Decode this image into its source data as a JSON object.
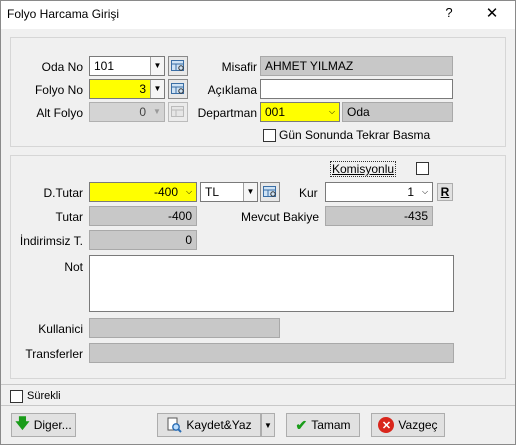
{
  "window": {
    "title": "Folyo Harcama Girişi",
    "help": "?",
    "close": "✕"
  },
  "top": {
    "oda_no": {
      "label": "Oda No",
      "value": "101"
    },
    "folyo_no": {
      "label": "Folyo No",
      "value": "3"
    },
    "alt_folyo": {
      "label": "Alt Folyo",
      "value": "0"
    },
    "misafir": {
      "label": "Misafir",
      "value": "AHMET YILMAZ"
    },
    "aciklama": {
      "label": "Açıklama",
      "value": ""
    },
    "departman": {
      "label": "Departman",
      "code": "001",
      "name": "Oda"
    },
    "gun_sonu": {
      "label": "Gün Sonunda Tekrar Basma",
      "checked": false
    }
  },
  "mid": {
    "komisyonlu": {
      "label": "Komisyonlu",
      "checked": false
    },
    "d_tutar": {
      "label": "D.Tutar",
      "value": "-400",
      "currency": "TL"
    },
    "kur": {
      "label": "Kur",
      "value": "1",
      "r_button": "R"
    },
    "tutar": {
      "label": "Tutar",
      "value": "-400"
    },
    "mevcut_bakiye": {
      "label": "Mevcut Bakiye",
      "value": "-435"
    },
    "indirimsiz": {
      "label": "İndirimsiz T.",
      "value": "0"
    },
    "not": {
      "label": "Not",
      "value": ""
    },
    "kullanici": {
      "label": "Kullanici",
      "value": ""
    },
    "transferler": {
      "label": "Transferler",
      "value": ""
    }
  },
  "bottom": {
    "surekli": {
      "label": "Sürekli",
      "checked": false
    },
    "diger": "Diger...",
    "kaydet_yaz": "Kaydet&Yaz",
    "tamam": "Tamam",
    "vazgec": "Vazgeç"
  },
  "icons": {
    "dropdown": "chevron-down",
    "lookup": "lookup-grid-icon"
  }
}
